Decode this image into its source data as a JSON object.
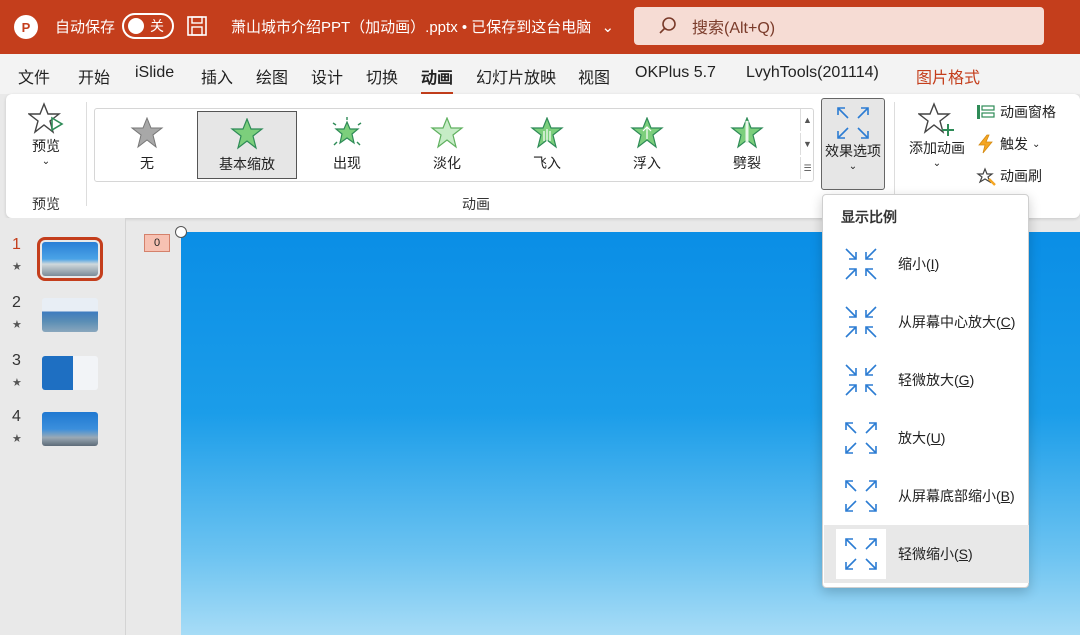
{
  "titlebar": {
    "logo": "P",
    "autosave_label": "自动保存",
    "autosave_state": "关",
    "document_title": "萧山城市介绍PPT（加动画）.pptx • 已保存到这台电脑",
    "search_placeholder": "搜索(Alt+Q)",
    "background_color": "#c43e1c"
  },
  "menu": {
    "tabs": [
      {
        "label": "文件"
      },
      {
        "label": "开始"
      },
      {
        "label": "iSlide"
      },
      {
        "label": "插入"
      },
      {
        "label": "绘图"
      },
      {
        "label": "设计"
      },
      {
        "label": "切换"
      },
      {
        "label": "动画",
        "active": true
      },
      {
        "label": "幻灯片放映"
      },
      {
        "label": "视图"
      },
      {
        "label": "OKPlus 5.7"
      },
      {
        "label": "LvyhTools(201114)"
      },
      {
        "label": "图片格式",
        "contextual": true
      }
    ]
  },
  "ribbon": {
    "preview_button": "预览",
    "preview_group": "预览",
    "animation_group": "动画",
    "gallery": [
      {
        "label": "无",
        "icon": "star-gray-icon"
      },
      {
        "label": "基本缩放",
        "icon": "star-green-icon",
        "selected": true
      },
      {
        "label": "出现",
        "icon": "star-burst-icon"
      },
      {
        "label": "淡化",
        "icon": "star-fade-icon"
      },
      {
        "label": "飞入",
        "icon": "star-fly-icon"
      },
      {
        "label": "浮入",
        "icon": "star-float-icon"
      },
      {
        "label": "劈裂",
        "icon": "star-split-icon"
      }
    ],
    "effect_options": "效果选项",
    "add_animation": "添加动画",
    "animation_pane": "动画窗格",
    "trigger": "触发",
    "animation_painter": "动画刷"
  },
  "slides": [
    {
      "number": "1",
      "star": "★",
      "active": true
    },
    {
      "number": "2",
      "star": "★"
    },
    {
      "number": "3",
      "star": "★"
    },
    {
      "number": "4",
      "star": "★"
    }
  ],
  "slide": {
    "animation_tag": "0"
  },
  "dropdown": {
    "header": "显示比例",
    "items": [
      {
        "text": "缩小(",
        "key": "I",
        "end": ")",
        "icon": "shrink-arrows-icon"
      },
      {
        "text": "从屏幕中心放大(",
        "key": "C",
        "end": ")",
        "icon": "shrink-arrows-icon"
      },
      {
        "text": "轻微放大(",
        "key": "G",
        "end": ")",
        "icon": "shrink-arrows-icon"
      },
      {
        "text": "放大(",
        "key": "U",
        "end": ")",
        "icon": "expand-arrows-icon"
      },
      {
        "text": "从屏幕底部缩小(",
        "key": "B",
        "end": ")",
        "icon": "expand-arrows-icon"
      },
      {
        "text": "轻微缩小(",
        "key": "S",
        "end": ")",
        "icon": "expand-arrows-icon",
        "highlight": true
      }
    ]
  }
}
